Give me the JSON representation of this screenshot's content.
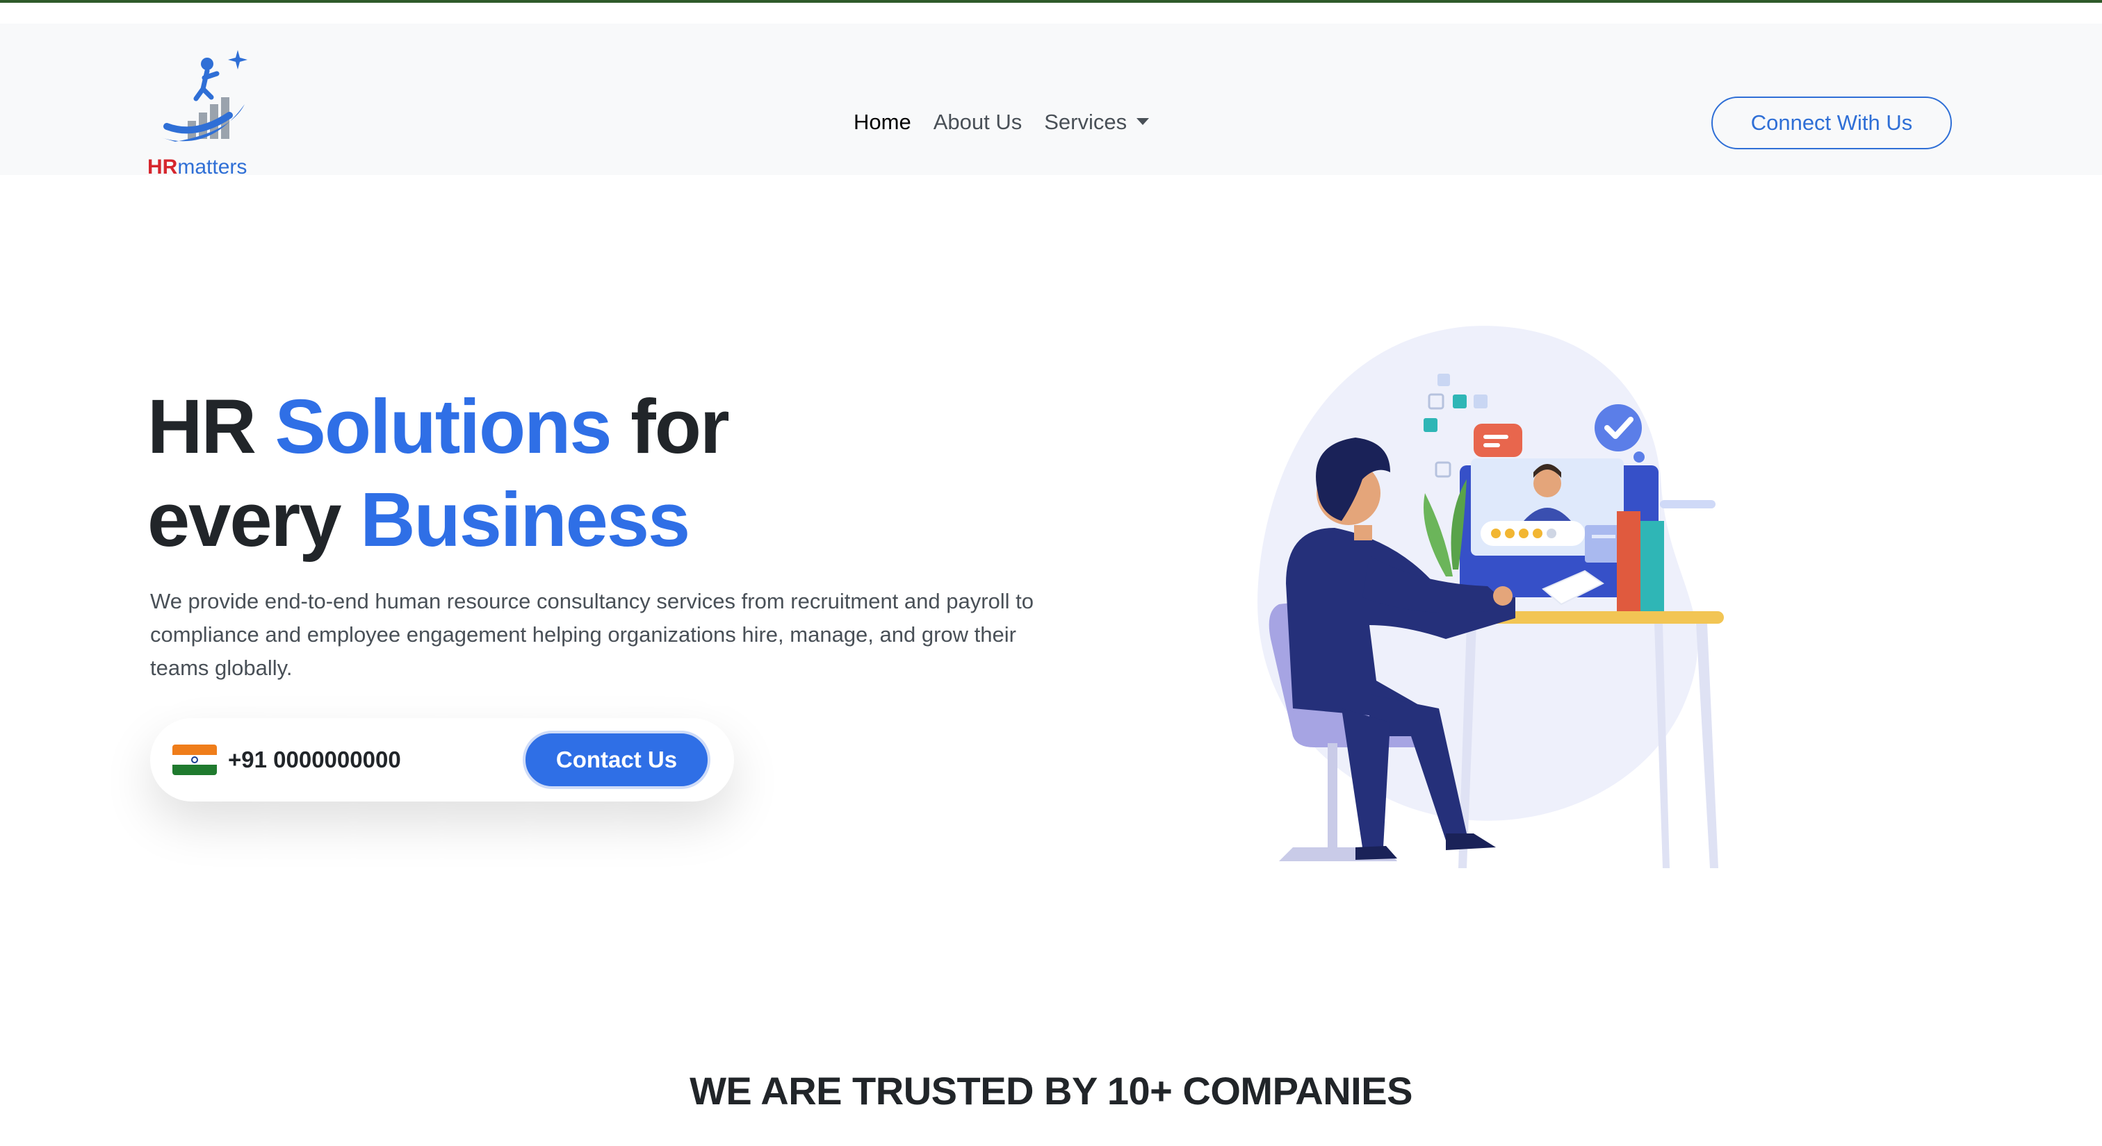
{
  "brand": {
    "logo_hr": "HR",
    "logo_matters": "matters"
  },
  "nav": {
    "items": [
      {
        "label": "Home",
        "active": true
      },
      {
        "label": "About Us",
        "active": false
      },
      {
        "label": "Services",
        "active": false,
        "dropdown": true
      }
    ],
    "cta_label": "Connect With Us"
  },
  "hero": {
    "title_part1": "HR ",
    "title_highlight1": "Solutions",
    "title_part2": " for",
    "title_part3": "every ",
    "title_highlight2": "Business",
    "description": "We provide end-to-end human resource consultancy services from recruitment and payroll to compliance and employee engagement helping organizations hire, manage, and grow their teams globally.",
    "phone": "+91 0000000000",
    "contact_label": "Contact Us",
    "flag_icon": "india-flag-icon"
  },
  "trusted": {
    "heading": "WE ARE TRUSTED BY 10+ COMPANIES"
  },
  "colors": {
    "accent": "#2f6fe6",
    "top_line": "#2f5a2a",
    "navbar_bg": "#f8f9fa",
    "logo_red": "#d6262d"
  }
}
